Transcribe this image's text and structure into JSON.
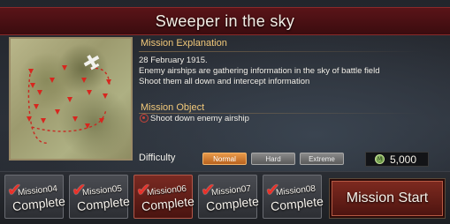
{
  "title": "Sweeper in the sky",
  "mission": {
    "explanation_heading": "Mission Explanation",
    "explanation_lines": [
      "28 February 1915.",
      "Enemy airships are gathering information in the sky of battle field",
      "Shoot them all down and intercept information"
    ],
    "object_heading": "Mission Object",
    "object_text": "Shoot down enemy airship",
    "object_icon": "target-icon"
  },
  "difficulty": {
    "label": "Difficulty",
    "options": [
      "Normal",
      "Hard",
      "Extreme"
    ],
    "selected": "Normal"
  },
  "cost": {
    "icon": "coin-icon",
    "icon_letter": "M",
    "value": "5,000"
  },
  "missions": [
    {
      "name": "Mission04",
      "status": "Complete"
    },
    {
      "name": "Mission05",
      "status": "Complete"
    },
    {
      "name": "Mission06",
      "status": "Complete"
    },
    {
      "name": "Mission07",
      "status": "Complete"
    },
    {
      "name": "Mission08",
      "status": "Complete"
    }
  ],
  "start_button": "Mission Start",
  "colors": {
    "title_bar": "#5a1418",
    "accent_heading": "#f2c97a",
    "selected_difficulty": "#e89a4a",
    "check_mark": "#e8322a",
    "enemy_marker": "#d8261e"
  }
}
